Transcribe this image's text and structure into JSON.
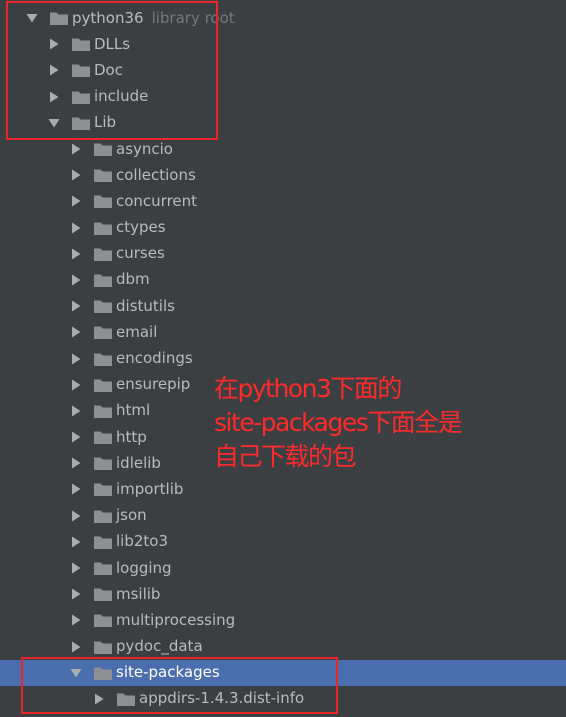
{
  "tree": {
    "root": {
      "label": "python36",
      "hint": "library root",
      "expanded": true
    },
    "top_children": [
      {
        "label": "DLLs",
        "expanded": false
      },
      {
        "label": "Doc",
        "expanded": false
      },
      {
        "label": "include",
        "expanded": false
      },
      {
        "label": "Lib",
        "expanded": true
      }
    ],
    "lib_children": [
      {
        "label": "asyncio",
        "expanded": false
      },
      {
        "label": "collections",
        "expanded": false
      },
      {
        "label": "concurrent",
        "expanded": false
      },
      {
        "label": "ctypes",
        "expanded": false
      },
      {
        "label": "curses",
        "expanded": false
      },
      {
        "label": "dbm",
        "expanded": false
      },
      {
        "label": "distutils",
        "expanded": false
      },
      {
        "label": "email",
        "expanded": false
      },
      {
        "label": "encodings",
        "expanded": false
      },
      {
        "label": "ensurepip",
        "expanded": false
      },
      {
        "label": "html",
        "expanded": false
      },
      {
        "label": "http",
        "expanded": false
      },
      {
        "label": "idlelib",
        "expanded": false
      },
      {
        "label": "importlib",
        "expanded": false
      },
      {
        "label": "json",
        "expanded": false
      },
      {
        "label": "lib2to3",
        "expanded": false
      },
      {
        "label": "logging",
        "expanded": false
      },
      {
        "label": "msilib",
        "expanded": false
      },
      {
        "label": "multiprocessing",
        "expanded": false
      },
      {
        "label": "pydoc_data",
        "expanded": false
      },
      {
        "label": "site-packages",
        "expanded": true,
        "selected": true
      }
    ],
    "site_packages_children": [
      {
        "label": "appdirs-1.4.3.dist-info",
        "expanded": false
      }
    ]
  },
  "annotation": {
    "lines": [
      "在python3下面的",
      "site-packages下面全是",
      "自己下载的包"
    ],
    "color": "#ff2a2a"
  },
  "colors": {
    "background": "#3c3f41",
    "selection": "#4b6eaf",
    "text": "#bbbbbb",
    "hint": "#787878",
    "folder": "#8d9092",
    "highlight_box": "#e8262c"
  },
  "icons": {
    "expanded": "triangle-down-icon",
    "collapsed": "triangle-right-icon",
    "folder": "folder-icon"
  }
}
